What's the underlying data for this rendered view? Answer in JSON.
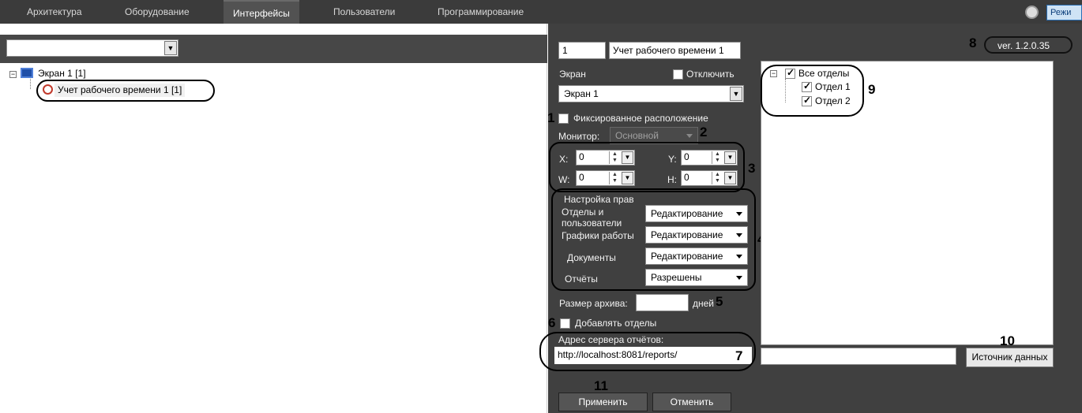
{
  "topbar": {
    "tabs": [
      {
        "label": "Архитектура"
      },
      {
        "label": "Оборудование"
      },
      {
        "label": "Интерфейсы"
      },
      {
        "label": "Пользователи"
      },
      {
        "label": "Программирование"
      }
    ],
    "mode_label": "Режи"
  },
  "left": {
    "tree": {
      "root": "Экран 1 [1]",
      "child": "Учет рабочего времени 1 [1]"
    }
  },
  "panel": {
    "id_value": "1",
    "name_value": "Учет рабочего времени 1",
    "screen_label": "Экран",
    "disable_label": "Отключить",
    "screen_value": "Экран 1",
    "fixed_label": "Фиксированное расположение",
    "monitor_label": "Монитор:",
    "monitor_value": "Основной",
    "x_label": "X:",
    "x_value": "0",
    "y_label": "Y:",
    "y_value": "0",
    "w_label": "W:",
    "w_value": "0",
    "h_label": "H:",
    "h_value": "0",
    "rights_title": "Настройка прав",
    "rights": [
      {
        "label": "Отделы и пользователи",
        "value": "Редактирование"
      },
      {
        "label": "Графики работы",
        "value": "Редактирование"
      },
      {
        "label": "Документы",
        "value": "Редактирование"
      },
      {
        "label": "Отчёты",
        "value": "Разрешены"
      }
    ],
    "archive_label": "Размер архива:",
    "archive_value": "",
    "days_label": "дней",
    "add_depts_label": "Добавлять отделы",
    "server_label": "Адрес сервера отчётов:",
    "server_value": "http://localhost:8081/reports/",
    "version": "ver. 1.2.0.35",
    "depts_tree": {
      "root": "Все отделы",
      "items": [
        "Отдел 1",
        "Отдел 2"
      ]
    },
    "datasource_value": "",
    "datasource_button": "Источник данных",
    "apply_button": "Применить",
    "cancel_button": "Отменить"
  },
  "callouts": [
    "1",
    "2",
    "3",
    "4",
    "5",
    "6",
    "7",
    "8",
    "9",
    "10",
    "11"
  ]
}
